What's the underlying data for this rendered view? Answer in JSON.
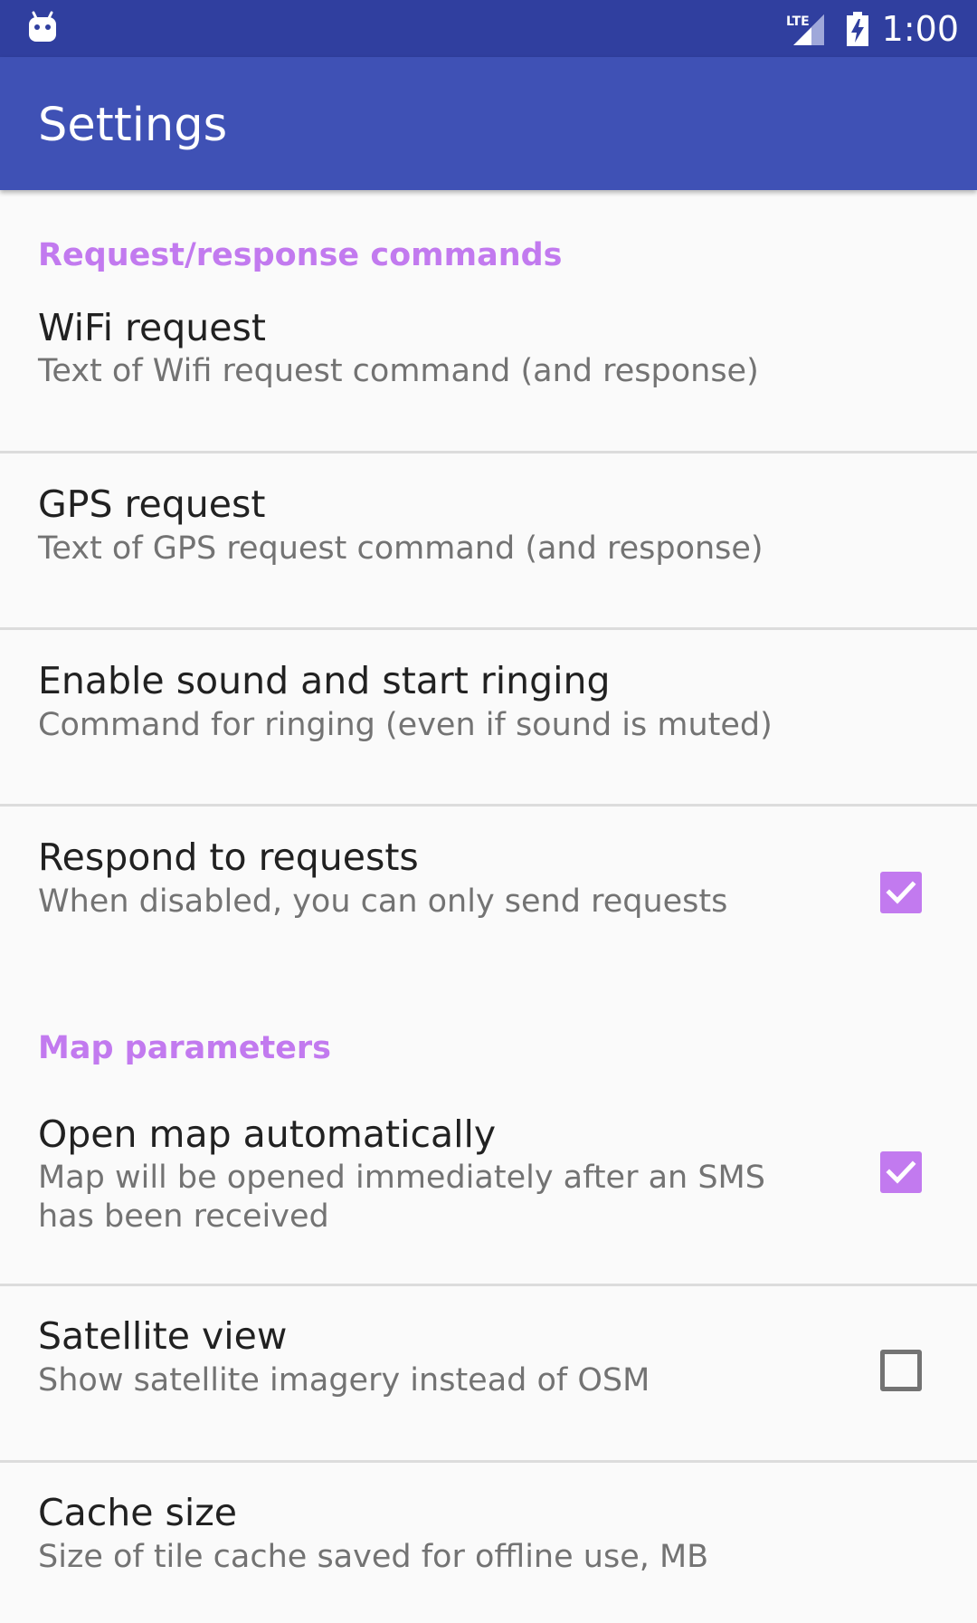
{
  "status_bar": {
    "time": "1:00",
    "network_label": "LTE",
    "icons": [
      "android-robot-icon",
      "lte-signal-icon",
      "battery-charging-icon"
    ]
  },
  "toolbar": {
    "title": "Settings"
  },
  "colors": {
    "status_bar": "#303f9f",
    "toolbar": "#3f51b5",
    "accent": "#c27aef",
    "background": "#fafafa"
  },
  "sections": [
    {
      "header": "Request/response commands",
      "items": [
        {
          "title": "WiFi request",
          "summary": "Text of Wifi request command (and response)"
        },
        {
          "title": "GPS request",
          "summary": "Text of GPS request command (and response)"
        },
        {
          "title": "Enable sound and start ringing",
          "summary": "Command for ringing (even if sound is muted)"
        },
        {
          "title": "Respond to requests",
          "summary": "When disabled, you can only send requests",
          "checked": true
        }
      ]
    },
    {
      "header": "Map parameters",
      "items": [
        {
          "title": "Open map automatically",
          "summary": "Map will be opened immediately after an SMS has been received",
          "checked": true
        },
        {
          "title": "Satellite view",
          "summary": "Show satellite imagery instead of OSM",
          "checked": false
        },
        {
          "title": "Cache size",
          "summary": "Size of tile cache saved for offline use, MB"
        }
      ]
    }
  ]
}
